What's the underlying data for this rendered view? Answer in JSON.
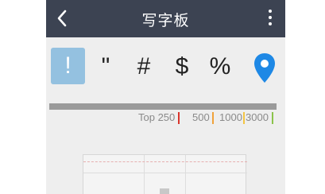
{
  "appbar": {
    "title": "写字板",
    "back_icon": "chevron-left-icon",
    "menu_icon": "more-vertical-icon"
  },
  "symbols": {
    "items": [
      "!",
      "\"",
      "#",
      "$",
      "%"
    ],
    "selected": "!",
    "location_icon": "map-pin-icon"
  },
  "ranks": {
    "labels": [
      "Top 250",
      "500",
      "1000",
      "3000"
    ],
    "colors": [
      "#d9342b",
      "#f0a23a",
      "#f4c542",
      "#8bc34a"
    ]
  },
  "colors": {
    "appbar": "#3c4352",
    "selected_symbol": "#94c1e0",
    "pin": "#1e88e5"
  }
}
